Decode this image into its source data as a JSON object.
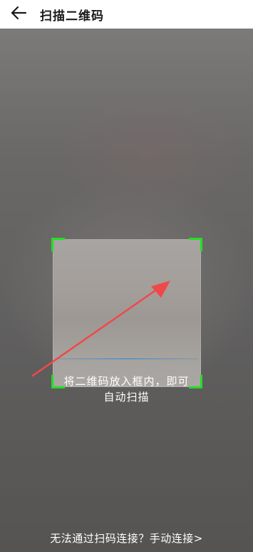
{
  "header": {
    "title": "扫描二维码"
  },
  "scanner": {
    "hint_line1": "将二维码放入框内，即可",
    "hint_line2": "自动扫描",
    "manual_link": "无法通过扫码连接？手动连接>"
  },
  "colors": {
    "corner": "#22e022",
    "scan_line": "#2882dc",
    "annotation_arrow": "#f0484a"
  },
  "icons": {
    "back": "arrow-left-icon"
  }
}
